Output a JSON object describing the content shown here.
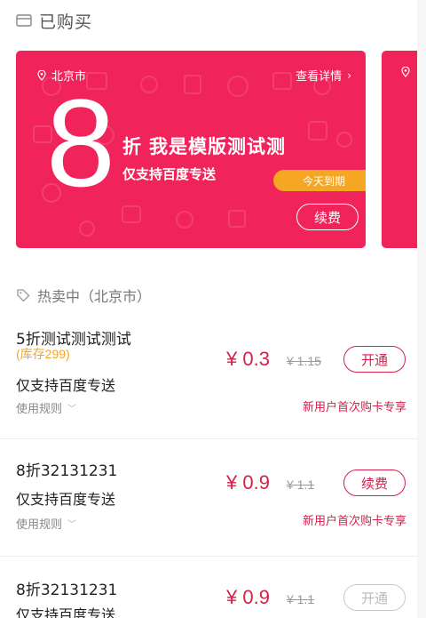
{
  "header": {
    "title": "已购买",
    "icon": "card-icon"
  },
  "card": {
    "city": "北京市",
    "details_label": "查看详情",
    "discount_number": "8",
    "zhe": "折",
    "card_name": "我是模版测试测",
    "delivery": "仅支持百度专送",
    "expire_badge": "今天到期",
    "renew_label": "续费",
    "color": "#f0245a",
    "badge_color": "#f5a623"
  },
  "hot": {
    "title": "热卖中（北京市）"
  },
  "products": [
    {
      "name": "5折测试测试测试",
      "stock": "(库存299)",
      "delivery": "仅支持百度专送",
      "rules": "使用规则",
      "price": "¥ 0.3",
      "original_price": "¥ 1.15",
      "action": "开通",
      "promo": "新用户首次购卡专享"
    },
    {
      "name": "8折32131231",
      "delivery": "仅支持百度专送",
      "rules": "使用规则",
      "price": "¥ 0.9",
      "original_price": "¥ 1.1",
      "action": "续费",
      "promo": "新用户首次购卡专享"
    },
    {
      "name": "8折32131231",
      "delivery": "仅支持百度专送",
      "price": "¥ 0.9",
      "original_price": "¥ 1.1",
      "action": "开通"
    }
  ],
  "colors": {
    "accent": "#d81e4b",
    "stock": "#f5a623"
  }
}
